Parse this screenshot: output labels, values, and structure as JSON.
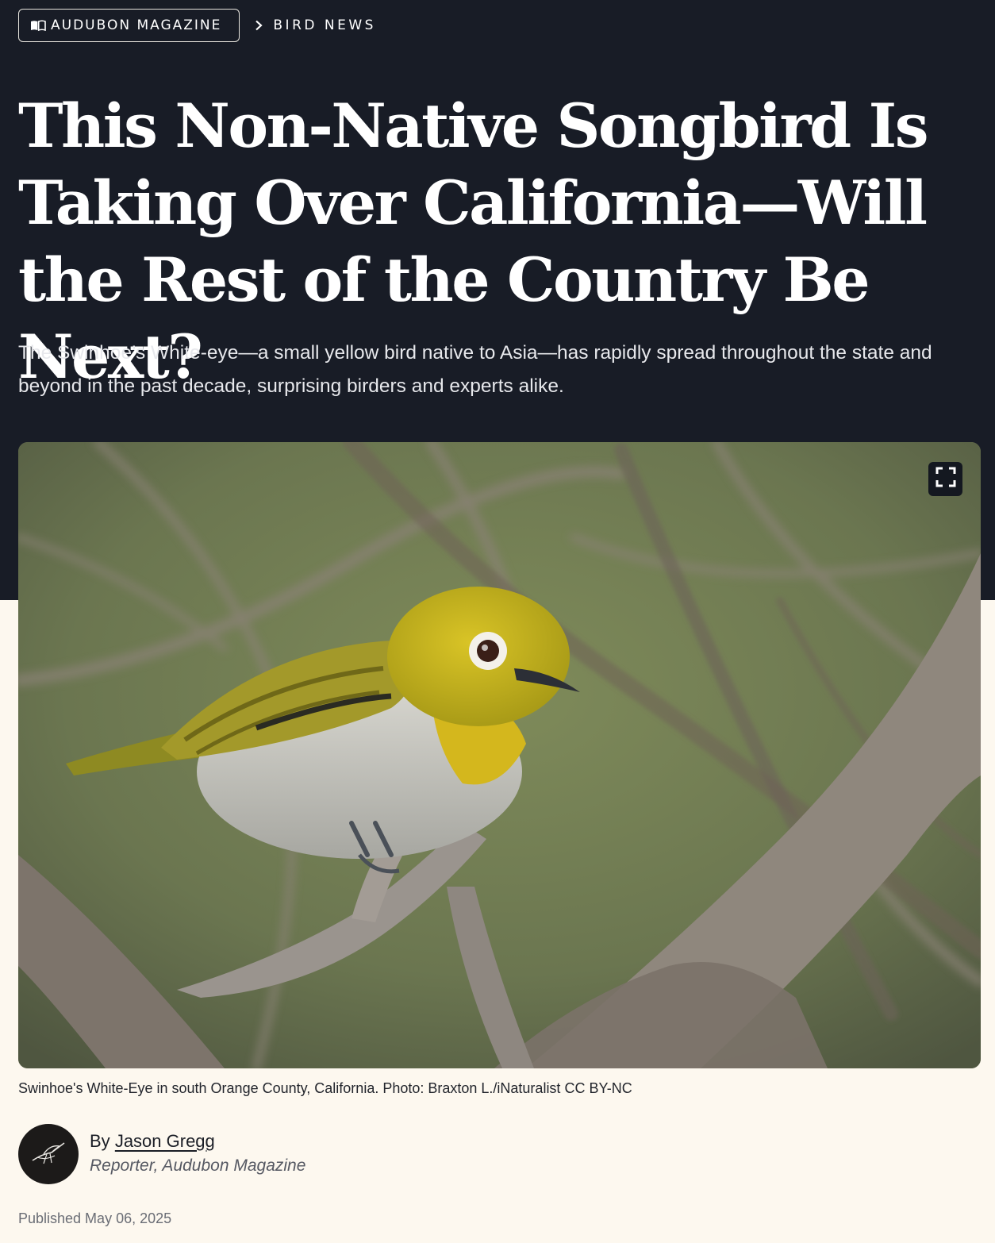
{
  "breadcrumb": {
    "section_label": "AUDUBON MAGAZINE",
    "section_icon": "open-book-icon",
    "separator_icon": "chevron-right-icon",
    "current_label": "BIRD NEWS"
  },
  "article": {
    "headline": "This Non-Native Songbird Is Taking Over California—Will the Rest of the Country Be Next?",
    "dek": "The Swinhoe’s White-eye—a small yellow bird native to Asia—has rapidly spread throughout the state and beyond in the past decade, surprising birders and experts alike.",
    "image": {
      "alt": "Swinhoe's White-Eye perched on a branch",
      "expand_icon": "fullscreen-icon",
      "caption": "Swinhoe's White-Eye in south Orange County, California. Photo: Braxton L./iNaturalist CC BY-NC"
    },
    "author": {
      "by_prefix": "By",
      "name": "Jason Gregg",
      "role": "Reporter, Audubon Magazine",
      "avatar_icon": "heron-logo-icon"
    },
    "published": "Published May 06, 2025"
  },
  "colors": {
    "header_bg": "#181c26",
    "page_bg": "#fdf8ef",
    "bird_yellow": "#c9b41c"
  }
}
